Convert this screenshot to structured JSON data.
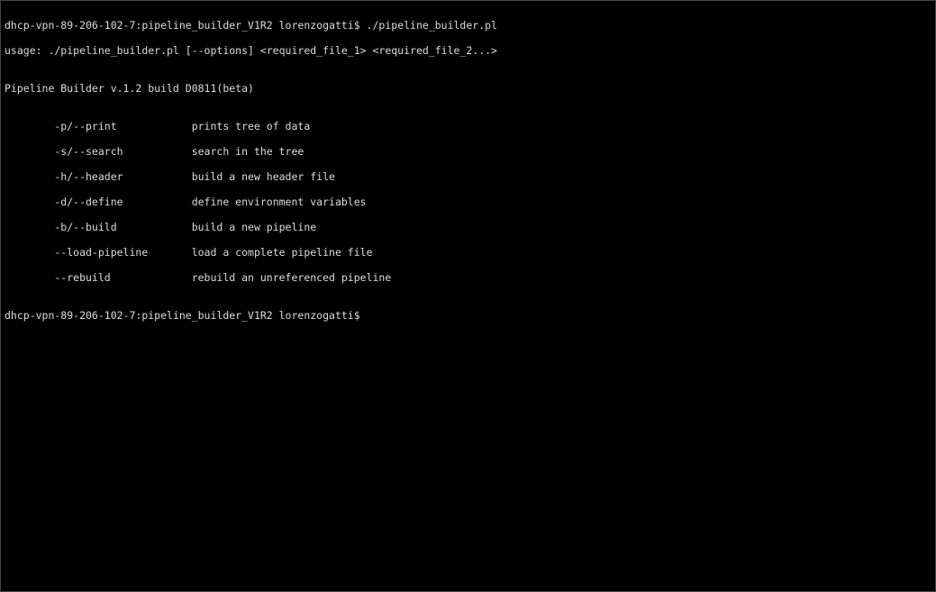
{
  "terminal": {
    "line1_prompt": "dhcp-vpn-89-206-102-7:pipeline_builder_V1R2 lorenzogatti$ ",
    "line1_cmd": "./pipeline_builder.pl",
    "line2": "usage: ./pipeline_builder.pl [--options] <required_file_1> <required_file_2...>",
    "blank1": "",
    "line3": "Pipeline Builder v.1.2 build D0811(beta)",
    "blank2": "",
    "opt1": "        -p/--print            prints tree of data",
    "opt2": "        -s/--search           search in the tree",
    "opt3": "        -h/--header           build a new header file",
    "opt4": "        -d/--define           define environment variables",
    "opt5": "        -b/--build            build a new pipeline",
    "opt6": "        --load-pipeline       load a complete pipeline file",
    "opt7": "        --rebuild             rebuild an unreferenced pipeline",
    "blank3": "",
    "line_last_prompt": "dhcp-vpn-89-206-102-7:pipeline_builder_V1R2 lorenzogatti$ "
  }
}
